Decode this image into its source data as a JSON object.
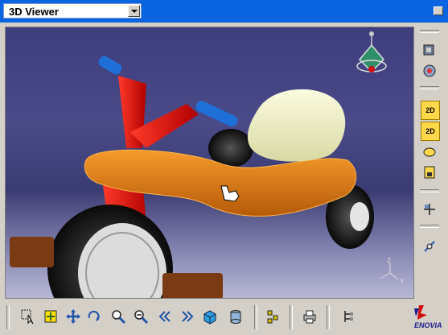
{
  "window": {
    "title": "3D Viewer"
  },
  "viewport": {
    "compass_icon": "compass-icon",
    "axis_labels": {
      "z": "Z",
      "y": "Y"
    },
    "cursor": "hand-cursor"
  },
  "right_toolbar": {
    "items": [
      {
        "icon": "fly-mode-icon"
      },
      {
        "icon": "view-orient-icon"
      },
      {
        "icon": "2d-view-icon",
        "text": "2D"
      },
      {
        "icon": "2d-multi-view-icon",
        "text": "2D"
      },
      {
        "icon": "rotate-view-icon"
      },
      {
        "icon": "save-view-icon"
      },
      {
        "icon": "grid-icon"
      },
      {
        "icon": "measure-icon"
      }
    ]
  },
  "bottom_toolbar": {
    "items": [
      {
        "icon": "select-icon"
      },
      {
        "icon": "fit-all-icon"
      },
      {
        "icon": "pan-icon"
      },
      {
        "icon": "rotate-icon"
      },
      {
        "icon": "zoom-in-icon"
      },
      {
        "icon": "zoom-out-icon"
      },
      {
        "icon": "rewind-icon"
      },
      {
        "icon": "forward-icon"
      },
      {
        "icon": "iso-view-icon"
      },
      {
        "icon": "render-mode-icon"
      },
      {
        "icon": "product-tree-icon"
      },
      {
        "icon": "print-icon"
      },
      {
        "icon": "hierarchy-icon"
      }
    ],
    "brand": "ENOVIA"
  }
}
